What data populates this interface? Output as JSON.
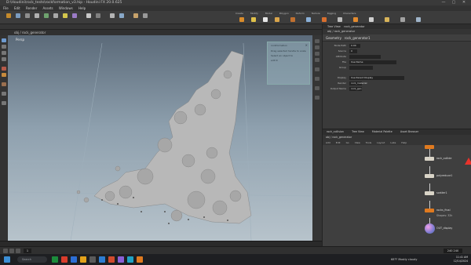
{
  "window": {
    "title": "D:\\Houdini\\rock_tests\\rockformation_v3.hip - Houdini FX 20.0.625",
    "controls": [
      "—",
      "▢",
      "✕"
    ]
  },
  "menu": [
    "File",
    "Edit",
    "Render",
    "Assets",
    "Windows",
    "Help"
  ],
  "shelf": {
    "set": "Main",
    "tabs": [
      "Create",
      "Modify",
      "Model",
      "Polygon",
      "Deform",
      "Texture",
      "Rigging",
      "Characters",
      "Constraints",
      "Hair Utils"
    ]
  },
  "viewport": {
    "label": "Persp",
    "info_panel": {
      "title": "rockformation",
      "lines": [
        "Drag selected handle to scale",
        "Select an object to",
        "edit it"
      ]
    },
    "path": "obj / rock_generator"
  },
  "params": {
    "tabs": [
      "Tree View",
      "rock_generator"
    ],
    "path": "obj / rock_generator",
    "node_type": "Geometry",
    "node_name": "rock_generator1",
    "rows": [
      {
        "label": "Node Path",
        "value": "0.00"
      },
      {
        "label": "Source",
        "value": "0"
      },
      {
        "label": "Attribute",
        "value": ""
      },
      {
        "label": "File",
        "value": "Use Name"
      },
      {
        "label": "Group",
        "value": ""
      },
      {
        "label": "Display",
        "value": "Use Parent Display"
      },
      {
        "label": "Render",
        "value": "rock_material"
      },
      {
        "label": "Output Name",
        "value": "rock_geo"
      }
    ]
  },
  "network": {
    "tabs": [
      "rock_collision",
      "Tree View",
      "Material Palette",
      "Asset Browser"
    ],
    "path": "obj / rock_generator",
    "menu": [
      "Add",
      "Edit",
      "Go",
      "View",
      "Tools",
      "Layout",
      "Labs",
      "Help"
    ],
    "nodes": [
      {
        "label": "rock_collide",
        "color": "#d9d4c7"
      },
      {
        "label": "polyreduce1",
        "color": "#d9d4c7"
      },
      {
        "label": "scatter1",
        "color": "#d9d4c7"
      },
      {
        "label": "voronoi1",
        "color": "#d9d4c7"
      },
      {
        "label": "rocks_final",
        "color": "#e07a1f"
      },
      {
        "label": "Shapes: 32k",
        "color": ""
      },
      {
        "label": "OUT_display",
        "color": ""
      }
    ]
  },
  "playbar": {
    "frame": "1",
    "end": "240  240"
  },
  "taskbar": {
    "search": "Search",
    "weather": "68°F  Mostly cloudy",
    "time": "11:41 AM",
    "date": "12/14/2024"
  },
  "colors": {
    "accent": "#e07a1f",
    "warning": "#e8332b",
    "viewport_top": "#5b6a79",
    "viewport_bottom": "#b7c3cb"
  }
}
